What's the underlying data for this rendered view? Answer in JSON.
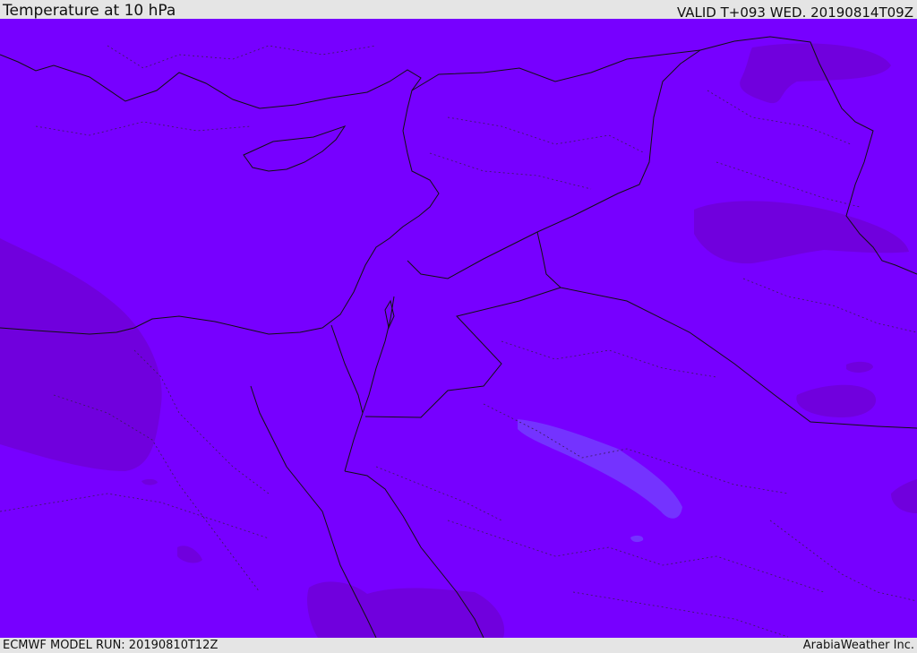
{
  "header": {
    "title": "Temperature at 10 hPa",
    "valid_time": "VALID T+093 WED. 20190814T09Z"
  },
  "footer": {
    "model_run": "ECMWF MODEL RUN: 20190810T12Z",
    "credit": "ArabiaWeather Inc."
  },
  "map": {
    "field": "Temperature",
    "level": "10 hPa",
    "colors": {
      "base": "#7700ff",
      "warmer_patch": "#7000dd",
      "cooler_patch": "#7433ff",
      "border": "#111111"
    }
  }
}
